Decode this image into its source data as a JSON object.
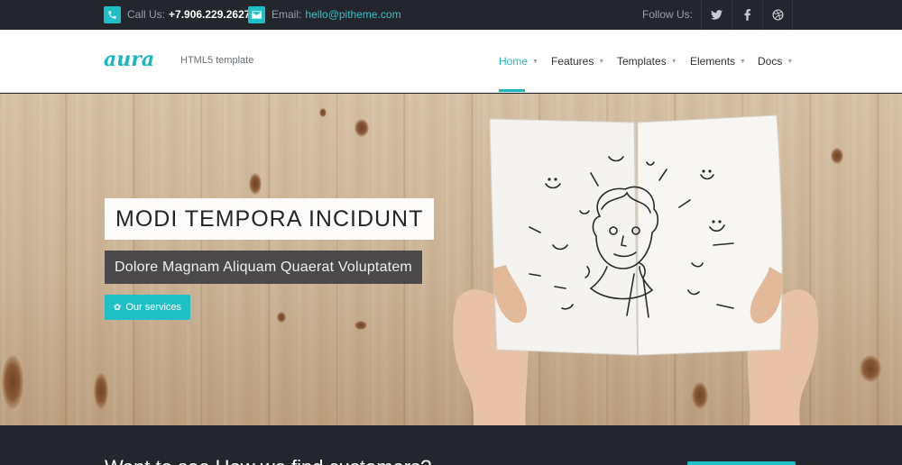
{
  "topbar": {
    "phone_label": "Call Us:",
    "phone_value": "+7.906.229.2627",
    "email_label": "Email:",
    "email_value": "hello@pitheme.com",
    "follow_label": "Follow Us:",
    "social_icons": [
      "twitter-icon",
      "facebook-icon",
      "dribbble-icon"
    ]
  },
  "header": {
    "logo_text": "aura",
    "tagline": "HTML5 template",
    "nav": [
      {
        "label": "Home",
        "active": true
      },
      {
        "label": "Features",
        "active": false
      },
      {
        "label": "Templates",
        "active": false
      },
      {
        "label": "Elements",
        "active": false
      },
      {
        "label": "Docs",
        "active": false
      }
    ]
  },
  "hero": {
    "headline": "MODI TEMPORA INCIDUNT",
    "subheadline": "Dolore Magnam Aliquam Quaerat Voluptatem",
    "cta_label": "Our services"
  },
  "band": {
    "text": "Want to see How we find customers?"
  },
  "colors": {
    "accent": "#1ec0c5",
    "dark": "#23262d",
    "headline_box": "#ffffff",
    "subline_box": "#404042"
  }
}
